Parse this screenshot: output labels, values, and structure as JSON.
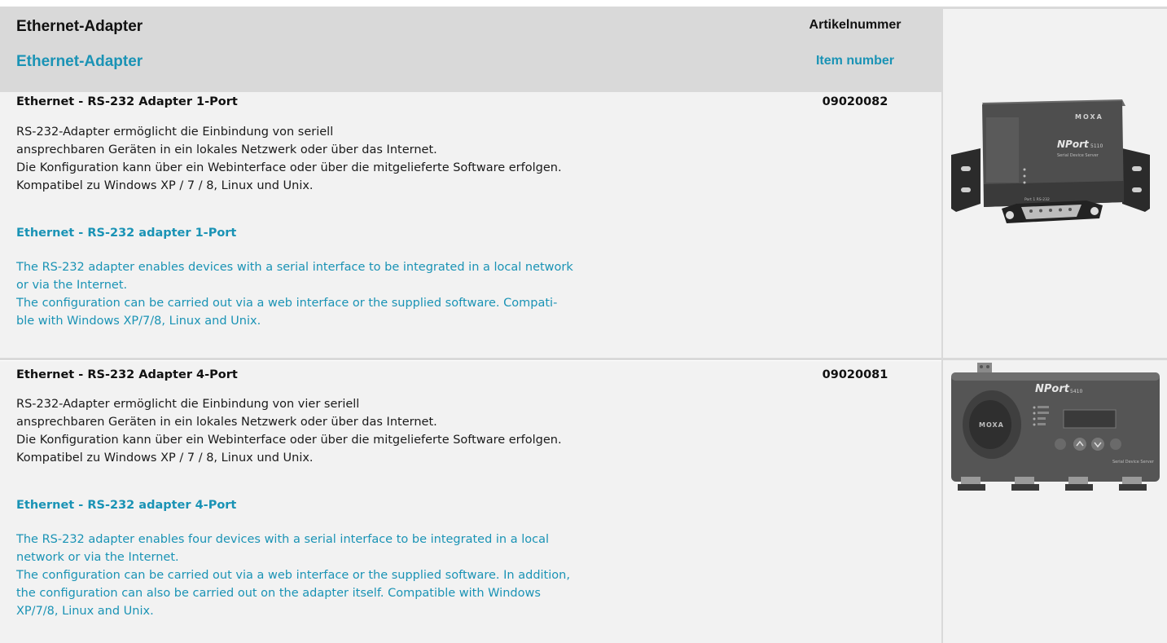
{
  "header": {
    "title_de": "Ethernet-Adapter",
    "title_en": "Ethernet-Adapter",
    "item_label_de": "Artikelnummer",
    "item_label_en": "Item number"
  },
  "products": [
    {
      "title_de": "Ethernet - RS-232 Adapter 1-Port",
      "desc_de": "RS-232-Adapter ermöglicht die Einbindung von seriell\nansprechbaren Geräten in ein lokales Netzwerk oder über das Internet.\nDie Konfiguration kann über ein Webinterface oder über die mitgelieferte Software erfolgen.\nKompatibel zu Windows XP / 7 / 8, Linux und Unix.",
      "title_en": "Ethernet - RS-232 adapter 1-Port",
      "desc_en": "The RS-232 adapter enables devices with a serial interface to be integrated in a local network\nor via the Internet.\nThe configuration can be carried out via a web interface or the supplied software. Compati-\nble with Windows XP/7/8, Linux and Unix.",
      "item_number": "09020082",
      "image": {
        "icon": "serial-device-server-1-port-photo",
        "brand": "MOXA",
        "model": "NPort",
        "model_no": "5110",
        "caption": "Serial Device Server",
        "port_label": "Port 1 RS-232"
      }
    },
    {
      "title_de": "Ethernet - RS-232 Adapter 4-Port",
      "desc_de": "RS-232-Adapter ermöglicht die Einbindung von vier seriell\nansprechbaren Geräten in ein lokales Netzwerk oder über das Internet.\nDie Konfiguration kann über ein Webinterface oder über die mitgelieferte Software erfolgen.\nKompatibel zu Windows XP / 7 / 8, Linux und Unix.",
      "title_en": "Ethernet - RS-232 adapter 4-Port",
      "desc_en": "The RS-232 adapter enables four devices with a serial interface to be integrated in a local\nnetwork or via the Internet.\nThe configuration can be carried out via a web interface or the supplied software. In addition,\nthe configuration can also be carried out on the adapter itself. Compatible with Windows\nXP/7/8, Linux and Unix.",
      "item_number": "09020081",
      "image": {
        "icon": "serial-device-server-4-port-photo",
        "brand": "MOXA",
        "model": "NPort",
        "model_no": "5410",
        "caption": "Serial Device Server"
      }
    }
  ]
}
